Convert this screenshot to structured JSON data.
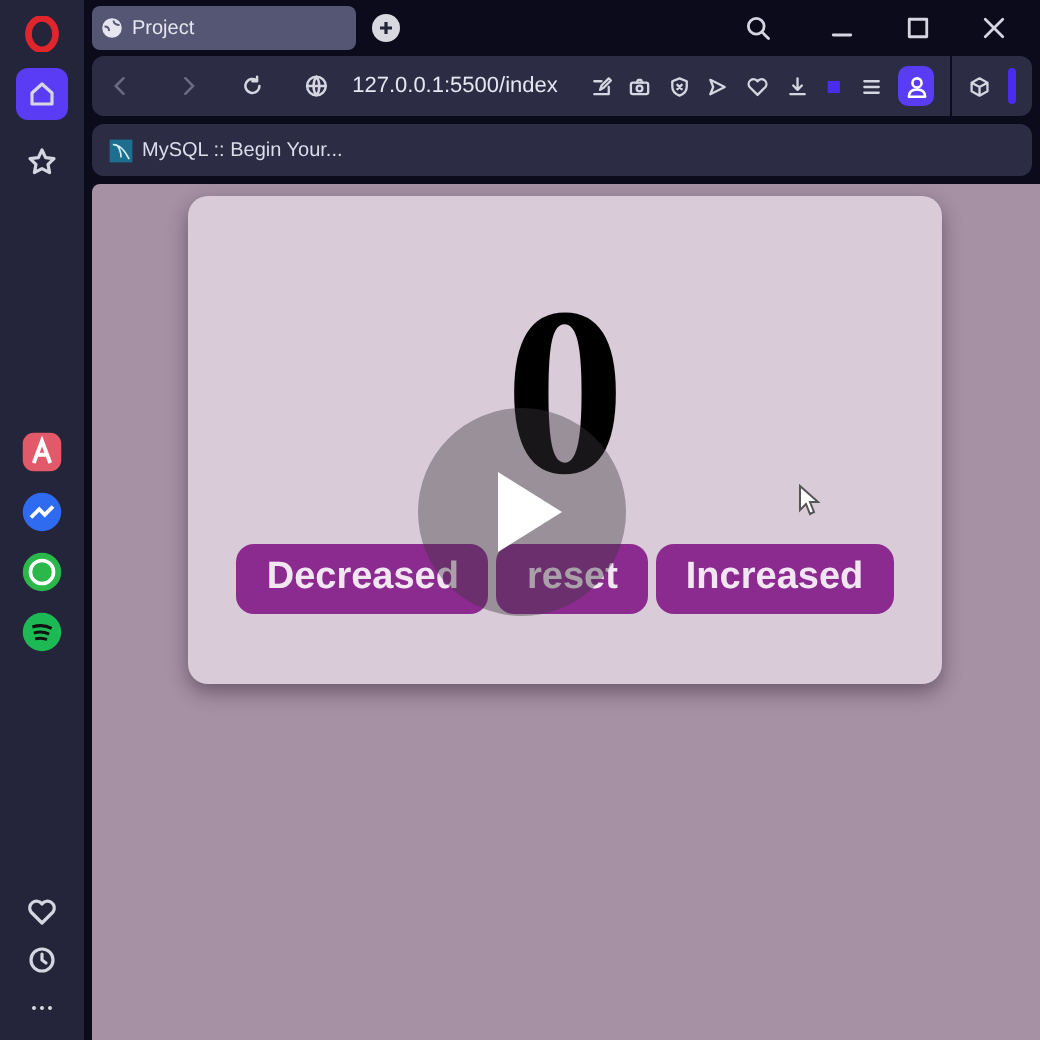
{
  "sidebar": {
    "items": [
      {
        "kind": "home",
        "selected": true
      },
      {
        "kind": "star",
        "selected": false
      }
    ]
  },
  "tabs": [
    {
      "title": "Project",
      "selected": true
    }
  ],
  "address_bar": {
    "url": "127.0.0.1:5500/index"
  },
  "bookmarks": [
    {
      "label": "MySQL :: Begin Your..."
    }
  ],
  "counter": {
    "value": "0"
  },
  "buttons": [
    {
      "label": "Decreased"
    },
    {
      "label": "reset"
    },
    {
      "label": "Increased"
    }
  ]
}
